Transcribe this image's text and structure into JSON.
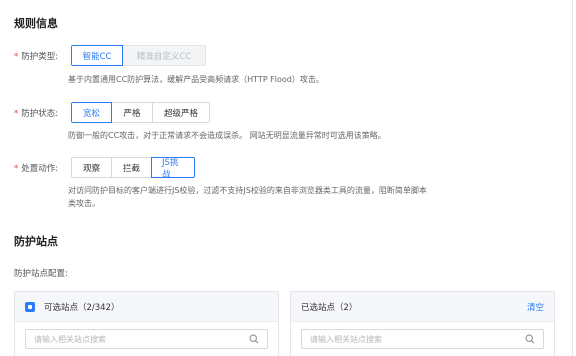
{
  "rule_info": {
    "title": "规则信息",
    "protection_type": {
      "label": "防护类型:",
      "options": [
        "智能CC",
        "精准自定义CC"
      ],
      "description": "基于内置通用CC防护算法，缓解产品受高频请求（HTTP Flood）攻击。"
    },
    "protection_state": {
      "label": "防护状态:",
      "options": [
        "宽松",
        "严格",
        "超级严格"
      ],
      "description": "防御一般的CC攻击，对于正常请求不会造成误杀。 网站无明显流量异常时可选用该策略。"
    },
    "action": {
      "label": "处置动作:",
      "options": [
        "观察",
        "拦截",
        "JS挑战"
      ],
      "description_line1": "对访问防护目标的客户端进行JS校验，过滤不支持JS校验的来自非浏览器类工具的流量，阻断简单脚本",
      "description_line2": "类攻击。"
    }
  },
  "protected_sites": {
    "title": "防护站点",
    "config_label": "防护站点配置:",
    "available": {
      "title": "可选站点（2/342）",
      "search_placeholder": "请输入相关站点搜索"
    },
    "selected": {
      "title": "已选站点（2）",
      "clear_label": "清空",
      "search_placeholder": "请输入相关站点搜索"
    }
  },
  "colors": {
    "accent": "#2b7cf6",
    "required": "#e8453c",
    "disabled_bg": "#f3f4f6"
  },
  "icons": {
    "search": "search-icon",
    "checkbox": "checkbox-indeterminate-icon"
  }
}
